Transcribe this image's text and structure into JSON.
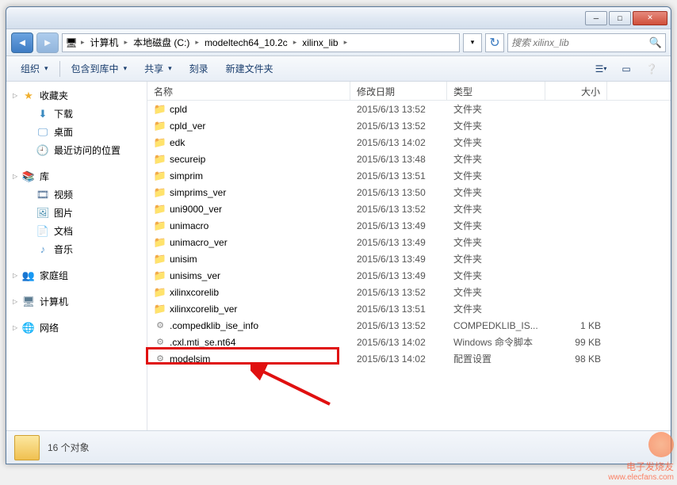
{
  "breadcrumb": {
    "items": [
      "计算机",
      "本地磁盘 (C:)",
      "modeltech64_10.2c",
      "xilinx_lib"
    ]
  },
  "search": {
    "placeholder": "搜索 xilinx_lib"
  },
  "toolbar": {
    "organize": "组织",
    "include": "包含到库中",
    "share": "共享",
    "burn": "刻录",
    "newfolder": "新建文件夹"
  },
  "sidebar": {
    "favorites": {
      "label": "收藏夹",
      "items": [
        "下载",
        "桌面",
        "最近访问的位置"
      ]
    },
    "libraries": {
      "label": "库",
      "items": [
        "视频",
        "图片",
        "文档",
        "音乐"
      ]
    },
    "homegroup": {
      "label": "家庭组"
    },
    "computer": {
      "label": "计算机"
    },
    "network": {
      "label": "网络"
    }
  },
  "columns": {
    "name": "名称",
    "date": "修改日期",
    "type": "类型",
    "size": "大小"
  },
  "files": [
    {
      "name": "cpld",
      "date": "2015/6/13 13:52",
      "type": "文件夹",
      "size": "",
      "icon": "folder"
    },
    {
      "name": "cpld_ver",
      "date": "2015/6/13 13:52",
      "type": "文件夹",
      "size": "",
      "icon": "folder"
    },
    {
      "name": "edk",
      "date": "2015/6/13 14:02",
      "type": "文件夹",
      "size": "",
      "icon": "folder"
    },
    {
      "name": "secureip",
      "date": "2015/6/13 13:48",
      "type": "文件夹",
      "size": "",
      "icon": "folder"
    },
    {
      "name": "simprim",
      "date": "2015/6/13 13:51",
      "type": "文件夹",
      "size": "",
      "icon": "folder"
    },
    {
      "name": "simprims_ver",
      "date": "2015/6/13 13:50",
      "type": "文件夹",
      "size": "",
      "icon": "folder"
    },
    {
      "name": "uni9000_ver",
      "date": "2015/6/13 13:52",
      "type": "文件夹",
      "size": "",
      "icon": "folder"
    },
    {
      "name": "unimacro",
      "date": "2015/6/13 13:49",
      "type": "文件夹",
      "size": "",
      "icon": "folder"
    },
    {
      "name": "unimacro_ver",
      "date": "2015/6/13 13:49",
      "type": "文件夹",
      "size": "",
      "icon": "folder"
    },
    {
      "name": "unisim",
      "date": "2015/6/13 13:49",
      "type": "文件夹",
      "size": "",
      "icon": "folder"
    },
    {
      "name": "unisims_ver",
      "date": "2015/6/13 13:49",
      "type": "文件夹",
      "size": "",
      "icon": "folder"
    },
    {
      "name": "xilinxcorelib",
      "date": "2015/6/13 13:52",
      "type": "文件夹",
      "size": "",
      "icon": "folder"
    },
    {
      "name": "xilinxcorelib_ver",
      "date": "2015/6/13 13:51",
      "type": "文件夹",
      "size": "",
      "icon": "folder"
    },
    {
      "name": ".compedklib_ise_info",
      "date": "2015/6/13 13:52",
      "type": "COMPEDKLIB_IS...",
      "size": "1 KB",
      "icon": "file"
    },
    {
      "name": ".cxl.mti_se.nt64",
      "date": "2015/6/13 14:02",
      "type": "Windows 命令脚本",
      "size": "99 KB",
      "icon": "file"
    },
    {
      "name": "modelsim",
      "date": "2015/6/13 14:02",
      "type": "配置设置",
      "size": "98 KB",
      "icon": "file"
    }
  ],
  "status": {
    "count": "16 个对象"
  },
  "watermark": {
    "line1": "电子发烧友",
    "line2": "www.elecfans.com"
  }
}
